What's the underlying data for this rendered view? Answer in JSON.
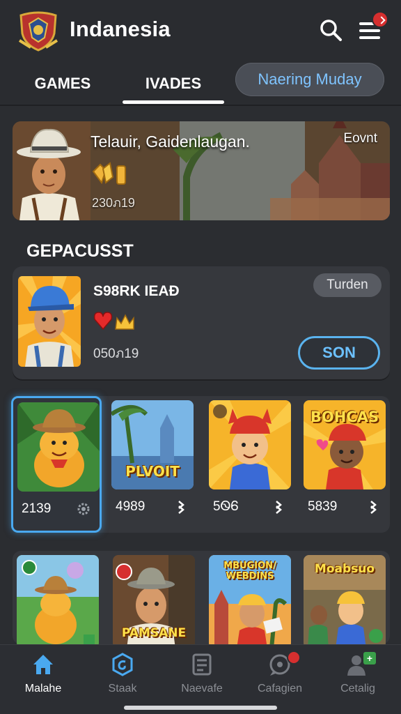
{
  "header": {
    "title": "Indanesia",
    "logo_icon": "shield-crest-icon",
    "search_icon": "search-icon",
    "menu_icon": "hamburger-menu-icon"
  },
  "tabs": {
    "games": "GAMES",
    "invades": "IVADES",
    "pill": "Naering Muday"
  },
  "banner": {
    "title": "Telauir, Gaidenlaugan.",
    "tag": "Eovnt",
    "count": "230ภ19"
  },
  "section": {
    "title": "GEPACUSST"
  },
  "featured": {
    "title": "S98RK IEAÐ",
    "badge": "Turden",
    "count": "050ภ19",
    "button": "SON"
  },
  "games_row1": [
    {
      "score": "2139",
      "action_icon": "gear-icon",
      "selected": true
    },
    {
      "score": "4989",
      "thumb_text": "PLVOIT",
      "action_icon": "chevron-icon"
    },
    {
      "score": "5ᏫᏮ",
      "action_icon": "chevron-icon"
    },
    {
      "score": "5839",
      "thumb_text": "BOHCAS",
      "action_icon": "chevron-icon"
    }
  ],
  "games_row2": [
    {
      "thumb_text": ""
    },
    {
      "thumb_text": "PAMSANE"
    },
    {
      "thumb_text": "MBUGION/ WEBDINS"
    },
    {
      "thumb_text": "Moabsuo"
    }
  ],
  "nav": [
    {
      "label": "Malahe",
      "icon": "home-icon"
    },
    {
      "label": "Staak",
      "icon": "hexagon-icon"
    },
    {
      "label": "Naevafe",
      "icon": "document-icon"
    },
    {
      "label": "Cafagien",
      "icon": "chat-icon"
    },
    {
      "label": "Cetalig",
      "icon": "user-add-icon"
    }
  ],
  "colors": {
    "accent": "#4aa9f0",
    "background": "#2b2d31",
    "card": "#36383d",
    "badge_red": "#d62f2f"
  }
}
